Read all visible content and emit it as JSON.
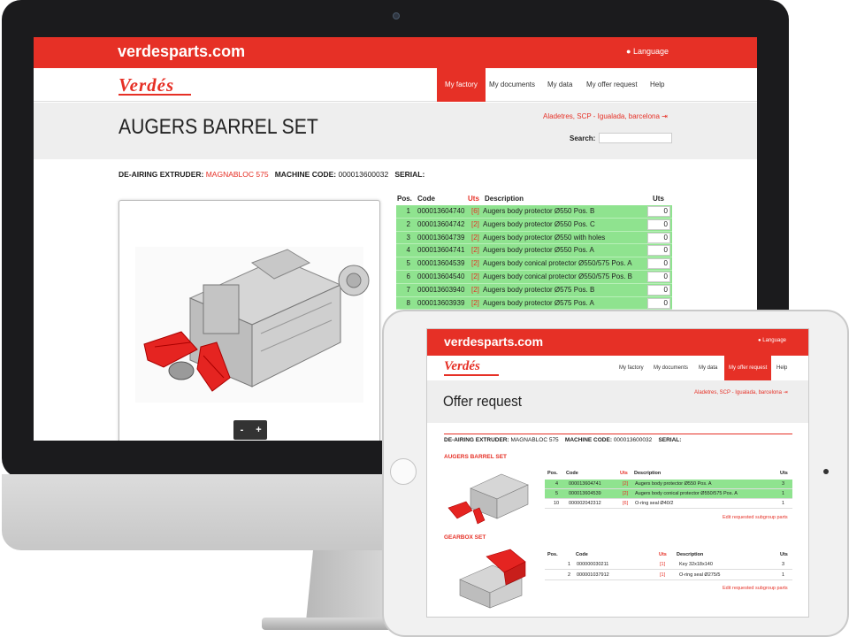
{
  "desktop": {
    "site_brand": "verdesparts.com",
    "language_label": "Language",
    "logo_text": "Verdés",
    "nav": [
      "My factory",
      "My documents",
      "My data",
      "My offer request",
      "Help"
    ],
    "active_nav": "My factory",
    "page_title": "AUGERS BARREL SET",
    "company_link": "Aladetres, SCP - Igualada, barcelona",
    "search_label": "Search:",
    "search_value": "",
    "machine_label": "DE-AIRING EXTRUDER:",
    "machine_name": "MAGNABLOC 575",
    "code_label": "MACHINE CODE:",
    "code_value": "000013600032",
    "serial_label": "SERIAL:",
    "table_headers": {
      "pos": "Pos.",
      "code": "Code",
      "uts": "Uts",
      "description": "Description",
      "qty": "Uts"
    },
    "rows": [
      {
        "pos": "1",
        "code": "000013604740",
        "uts": "[6]",
        "description": "Augers body protector Ø550 Pos. B",
        "qty": "0"
      },
      {
        "pos": "2",
        "code": "000013604742",
        "uts": "[2]",
        "description": "Augers body protector Ø550 Pos. C",
        "qty": "0"
      },
      {
        "pos": "3",
        "code": "000013604739",
        "uts": "[2]",
        "description": "Augers body protector Ø550 with holes",
        "qty": "0"
      },
      {
        "pos": "4",
        "code": "000013604741",
        "uts": "[2]",
        "description": "Augers body protector Ø550 Pos. A",
        "qty": "0"
      },
      {
        "pos": "5",
        "code": "000013604539",
        "uts": "[2]",
        "description": "Augers body conical protector Ø550/575 Pos. A",
        "qty": "0"
      },
      {
        "pos": "6",
        "code": "000013604540",
        "uts": "[2]",
        "description": "Augers body conical protector Ø550/575 Pos. B",
        "qty": "0"
      },
      {
        "pos": "7",
        "code": "000013603940",
        "uts": "[2]",
        "description": "Augers body protector Ø575 Pos. B",
        "qty": "0"
      },
      {
        "pos": "8",
        "code": "000013603939",
        "uts": "[2]",
        "description": "Augers body protector Ø575 Pos. A",
        "qty": "0"
      }
    ],
    "zoom_minus": "-",
    "zoom_plus": "+"
  },
  "tablet": {
    "site_brand": "verdesparts.com",
    "language_label": "Language",
    "logo_text": "Verdés",
    "nav": [
      "My factory",
      "My documents",
      "My data",
      "My offer request",
      "Help"
    ],
    "active_nav": "My offer request",
    "page_title": "Offer request",
    "company_link": "Aladetres, SCP - Igualada, barcelona",
    "machine_label": "DE-AIRING EXTRUDER:",
    "machine_name": "MAGNABLOC 575",
    "code_label": "MACHINE CODE:",
    "code_value": "000013600032",
    "serial_label": "SERIAL:",
    "sections": [
      {
        "title": "AUGERS BARREL SET",
        "headers": {
          "pos": "Pos.",
          "code": "Code",
          "uts": "Uts",
          "description": "Description",
          "qty": "Uts"
        },
        "rows": [
          {
            "pos": "4",
            "code": "000013604741",
            "uts": "[2]",
            "description": "Augers body protector Ø550 Pos. A",
            "qty": "3",
            "highlight": true
          },
          {
            "pos": "5",
            "code": "000013604539",
            "uts": "[2]",
            "description": "Augers body conical protector Ø550/575 Pos. A",
            "qty": "1",
            "highlight": true
          },
          {
            "pos": "10",
            "code": "000002042312",
            "uts": "[6]",
            "description": "O-ring seal Ø40/2",
            "qty": "1",
            "highlight": false
          }
        ],
        "edit_link": "Edit requested subgroup parts"
      },
      {
        "title": "GEARBOX SET",
        "headers": {
          "pos": "Pos.",
          "code": "Code",
          "uts": "Uts",
          "description": "Description",
          "qty": "Uts"
        },
        "rows": [
          {
            "pos": "1",
            "code": "000000030211",
            "uts": "[1]",
            "description": "Key 32x18x140",
            "qty": "3",
            "highlight": false
          },
          {
            "pos": "2",
            "code": "000001037912",
            "uts": "[1]",
            "description": "O-ring seal Ø275/5",
            "qty": "1",
            "highlight": false
          }
        ],
        "edit_link": "Edit requested subgroup parts"
      }
    ]
  },
  "colors": {
    "brand_red": "#e63026",
    "row_green": "#8fe38f",
    "header_grey": "#eeeeee"
  },
  "icons": [
    "globe-icon",
    "logout-icon"
  ]
}
